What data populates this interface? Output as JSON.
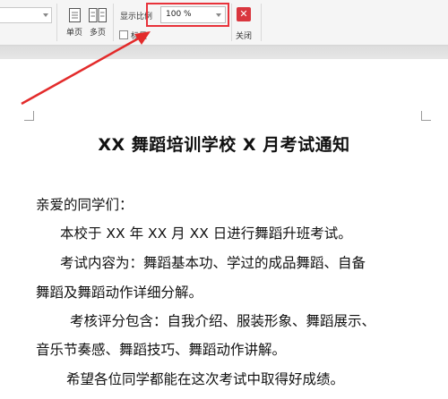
{
  "toolbar": {
    "single_page_label": "单页",
    "multi_page_label": "多页",
    "zoom_label": "显示比例",
    "zoom_value": "100 %",
    "ruler_label": "标尺",
    "close_label": "关闭",
    "close_glyph": "✕"
  },
  "document": {
    "title": "XX 舞蹈培训学校 X 月考试通知",
    "lines": [
      "亲爱的同学们：",
      "本校于 XX 年 XX 月 XX 日进行舞蹈升班考试。",
      "考试内容为：舞蹈基本功、学过的成品舞蹈、自备",
      "舞蹈及舞蹈动作详细分解。",
      "考核评分包含：自我介绍、服装形象、舞蹈展示、",
      "音乐节奏感、舞蹈技巧、舞蹈动作讲解。",
      "希望各位同学都能在这次考试中取得好成绩。"
    ]
  },
  "colors": {
    "highlight": "#e8323a",
    "close_button": "#d9363e"
  }
}
